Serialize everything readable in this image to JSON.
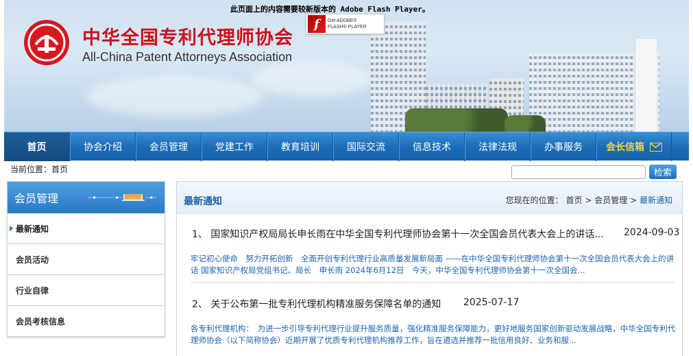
{
  "banner": {
    "flash_notice": "此页面上的内容需要较新版本的 Adobe Flash Player。",
    "flash_badge": {
      "line1": "Get ADOBE®",
      "line2": "FLASH® PLAYER"
    },
    "title_cn": "中华全国专利代理师协会",
    "title_en": "All-China Patent Attorneys Association"
  },
  "nav": {
    "items": [
      {
        "label": "首页"
      },
      {
        "label": "协会介绍"
      },
      {
        "label": "会员管理"
      },
      {
        "label": "党建工作"
      },
      {
        "label": "教育培训"
      },
      {
        "label": "国际交流"
      },
      {
        "label": "信息技术"
      },
      {
        "label": "法律法规"
      },
      {
        "label": "办事服务"
      }
    ],
    "president": "会长信箱"
  },
  "location": "当前位置：首页",
  "search": {
    "button": "检索"
  },
  "sidebar": {
    "title": "会员管理",
    "items": [
      {
        "label": "最新通知"
      },
      {
        "label": "会员活动"
      },
      {
        "label": "行业自律"
      },
      {
        "label": "会员考核信息"
      }
    ]
  },
  "main": {
    "title": "最新通知",
    "crumb_prefix": "您现在的位置：",
    "crumb_1": "首页",
    "crumb_2": "会员管理",
    "crumb_3": "最新通知",
    "sep": ">",
    "news": [
      {
        "title": "1、 国家知识产权局局长申长雨在中华全国专利代理师协会第十一次全国会员代表大会上的讲话...",
        "date": "2024-09-03",
        "summary": "牢记初心使命　努力开拓创新　全面开创专利代理行业高质量发展新局面 ——在中华全国专利代理师协会第十一次全国会员代表大会上的讲话 国家知识产权局党组书记、局长　申长雨 2024年6月12日　今天，中华全国专利代理师协会第十一次全国会..."
      },
      {
        "title": "2、 关于公布第一批专利代理机构精准服务保障名单的通知",
        "date": "2025-07-17",
        "summary": "各专利代理机构：　为进一步引导专利代理行业提升服务质量，强化精准服务保障能力，更好地服务国家创新驱动发展战略，中华全国专利代理师协会（以下简称协会）近期开展了优质专利代理机构推荐工作，旨在遴选并推荐一批信用良好、业务和服..."
      }
    ]
  },
  "colors": {
    "brand_red": "#d8161f",
    "nav_blue": "#1c6db6",
    "link_blue": "#1d64b0",
    "president_yellow": "#ffd23a"
  }
}
